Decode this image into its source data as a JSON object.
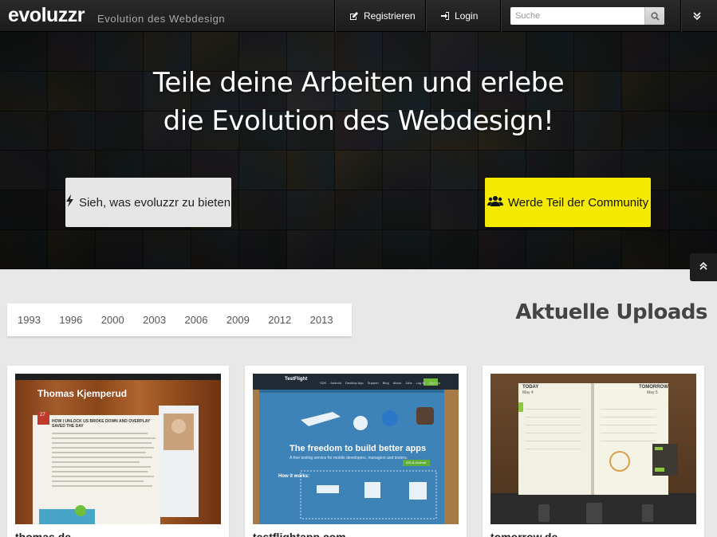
{
  "navbar": {
    "logo": "evoluzzr",
    "tagline": "Evolution des Webdesign",
    "register_label": "Registrieren",
    "login_label": "Login",
    "search_placeholder": "Suche"
  },
  "hero": {
    "title_line1": "Teile deine Arbeiten und erlebe",
    "title_line2": "die Evolution des Webdesign!",
    "features_button": "Sieh, was evoluzzr zu bieten",
    "community_button": "Werde Teil der Community",
    "accent_yellow": "#f5ea00"
  },
  "years": [
    "1993",
    "1996",
    "2000",
    "2003",
    "2006",
    "2009",
    "2012",
    "2013"
  ],
  "uploads": {
    "title": "Aktuelle Uploads",
    "cards": [
      {
        "name": "thomas.de",
        "preview": {
          "site_title": "Thomas Kjemperud",
          "post_heading": "HOW I UNLOCK US BROKE DOWN AND OVERPLAY SAVED THE DAY",
          "date_day": "27"
        }
      },
      {
        "name": "testflightapp.com",
        "preview": {
          "brand": "TestFlight",
          "headline": "The freedom to build better apps",
          "subhead": "A free testing service for mobile developers, managers and testers.",
          "section": "How it works:",
          "nav": [
            "SDK",
            "Android",
            "Desktop App",
            "Support",
            "Blog",
            "About",
            "Jobs",
            "Log In",
            "Sign Up"
          ],
          "badge": "iOS & Android"
        }
      },
      {
        "name": "tomorrow.de",
        "preview": {
          "left_page": "TODAY",
          "right_page": "TOMORROW",
          "left_date": "May 4",
          "right_date": "May 5"
        }
      }
    ]
  }
}
